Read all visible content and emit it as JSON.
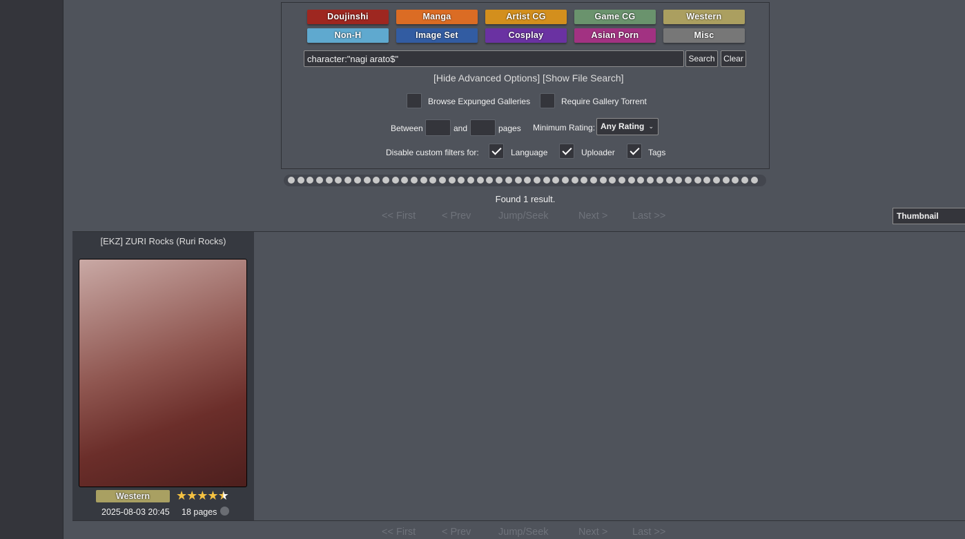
{
  "categories": [
    {
      "label": "Doujinshi",
      "color": "#9e2720"
    },
    {
      "label": "Manga",
      "color": "#db6c24"
    },
    {
      "label": "Artist CG",
      "color": "#d38f1d"
    },
    {
      "label": "Game CG",
      "color": "#6a936d"
    },
    {
      "label": "Western",
      "color": "#ab9f60"
    },
    {
      "label": "Non-H",
      "color": "#5fa9cf"
    },
    {
      "label": "Image Set",
      "color": "#325ca2"
    },
    {
      "label": "Cosplay",
      "color": "#6a32a2"
    },
    {
      "label": "Asian Porn",
      "color": "#a23282"
    },
    {
      "label": "Misc",
      "color": "#777777"
    }
  ],
  "search": {
    "value": "character:\"nagi arato$\"",
    "search_label": "Search",
    "clear_label": "Clear",
    "hide_advanced": "[Hide Advanced Options]",
    "show_file_search": "[Show File Search]"
  },
  "advanced": {
    "expunged": "Browse Expunged Galleries",
    "torrent": "Require Gallery Torrent",
    "between": "Between",
    "and": "and",
    "pages": "pages",
    "min_rating": "Minimum Rating:",
    "rating_value": "Any Rating",
    "disable_filters": "Disable custom filters for:",
    "language": "Language",
    "uploader": "Uploader",
    "tags": "Tags"
  },
  "results": {
    "found": "Found 1 result.",
    "display_mode": "Thumbnail"
  },
  "pager": {
    "first": "<< First",
    "prev": "< Prev",
    "jump": "Jump/Seek",
    "next": "Next >",
    "last": "Last >>"
  },
  "gallery": {
    "title": "[EKZ] ZURI Rocks (Ruri Rocks)",
    "category": "Western",
    "rating": 4.5,
    "date": "2025-08-03 20:45",
    "pages": "18 pages"
  }
}
